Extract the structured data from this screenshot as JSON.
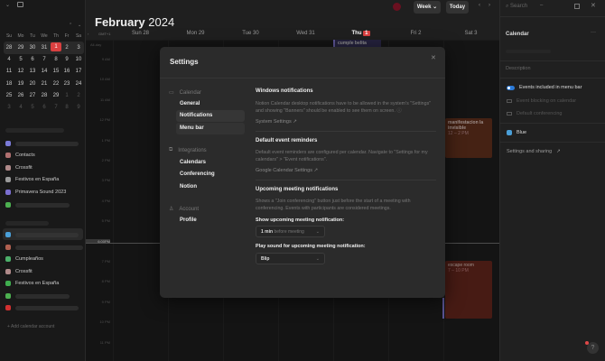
{
  "sidebar": {
    "mini_cal": {
      "weekdays": [
        "Su",
        "Mo",
        "Tu",
        "We",
        "Th",
        "Fr",
        "Sa"
      ],
      "weeks": [
        [
          "28",
          "29",
          "30",
          "31",
          "1",
          "2",
          "3"
        ],
        [
          "4",
          "5",
          "6",
          "7",
          "8",
          "9",
          "10"
        ],
        [
          "11",
          "12",
          "13",
          "14",
          "15",
          "16",
          "17"
        ],
        [
          "18",
          "19",
          "20",
          "21",
          "22",
          "23",
          "24"
        ],
        [
          "25",
          "26",
          "27",
          "28",
          "29",
          "1",
          "2"
        ],
        [
          "3",
          "4",
          "5",
          "6",
          "7",
          "8",
          "9"
        ]
      ],
      "today": "1"
    },
    "group1": [
      {
        "label": "Contacts",
        "color": "#b07070"
      },
      {
        "label": "Crossfit",
        "color": "#b08a8a"
      },
      {
        "label": "Festivos en España",
        "color": "#9a9a9a"
      },
      {
        "label": "Primavera Sound 2023",
        "color": "#7b6fd0"
      }
    ],
    "group2": [
      {
        "label": "Cumpleaños",
        "color": "#4caf6a"
      },
      {
        "label": "Crossfit",
        "color": "#b08a8a"
      },
      {
        "label": "Festivos en España",
        "color": "#3fae4f"
      }
    ],
    "add_account": "Add calendar account"
  },
  "header": {
    "month": "February",
    "year": "2024",
    "view": "Week",
    "today": "Today",
    "tz": "GMT+1",
    "allday": "All-day"
  },
  "days": [
    "Sun 28",
    "Mon 29",
    "Tue 30",
    "Wed 31",
    "Thu",
    "Fri 2",
    "Sat 3"
  ],
  "today_badge": "1",
  "times": [
    "9 AM",
    "10 AM",
    "11 AM",
    "12 PM",
    "1 PM",
    "2 PM",
    "3 PM",
    "4 PM",
    "5 PM",
    "6:00PM",
    "7 PM",
    "8 PM",
    "9 PM",
    "10 PM",
    "11 PM"
  ],
  "events": {
    "allday": {
      "title": "cumple belita"
    },
    "manif": {
      "title": "manifestacion la invisible",
      "time": "12 – 2 PM",
      "color": "#6b3520"
    },
    "escape": {
      "title": "escape room",
      "time": "7 – 10 PM",
      "color": "#6e2a1f"
    }
  },
  "right": {
    "search": "Search",
    "title": "Calendar",
    "description": "Description",
    "menu_bar": "Events included in menu bar",
    "blocking": "Event blocking on calendar",
    "conferencing": "Default conferencing",
    "color_name": "Blue",
    "color": "#4a9fd8",
    "settings": "Settings and sharing"
  },
  "settings": {
    "title": "Settings",
    "nav": {
      "calendar": "Calendar",
      "general": "General",
      "notifications": "Notifications",
      "menubar": "Menu bar",
      "integrations": "Integrations",
      "calendars": "Calendars",
      "conferencing": "Conferencing",
      "notion": "Notion",
      "account": "Account",
      "profile": "Profile"
    },
    "win_title": "Windows notifications",
    "win_text": "Notion Calendar desktop notifications have to be allowed in the system's \"Settings\" and showing \"Banners\" should be enabled to see them on screen.",
    "system_settings": "System Settings",
    "rem_title": "Default event reminders",
    "rem_text": "Default event reminders are configured per calendar. Navigate to \"Settings for my calendars\" > \"Event notifications\".",
    "gcal": "Google Calendar Settings",
    "up_title": "Upcoming meeting notifications",
    "up_text": "Shows a \"Join conferencing\" button just before the start of a meeting with conferencing. Events with participants are considered meetings.",
    "show_label": "Show upcoming meeting notification:",
    "show_value": "1 min",
    "show_suffix": "before meeting",
    "sound_label": "Play sound for upcoming meeting notification:",
    "sound_value": "Blip"
  },
  "help": "?"
}
